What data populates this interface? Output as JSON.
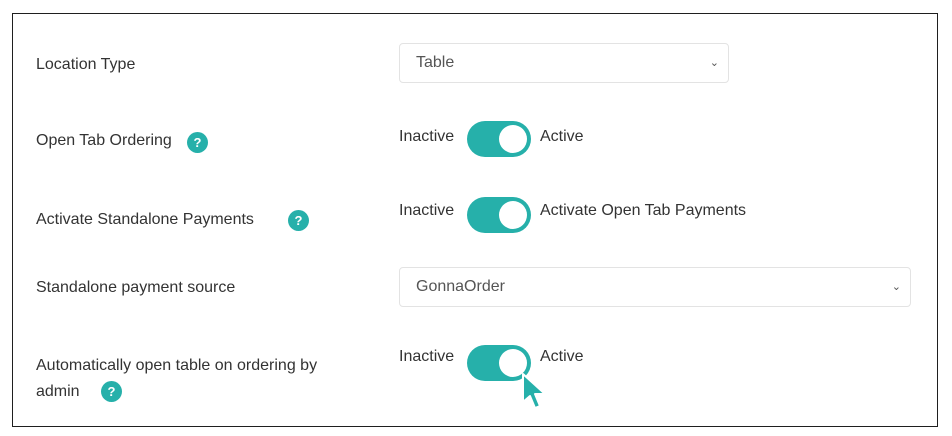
{
  "form": {
    "location_type": {
      "label": "Location Type",
      "value": "Table"
    },
    "open_tab_ordering": {
      "label": "Open Tab Ordering",
      "help": "?",
      "off_label": "Inactive",
      "on_label": "Active",
      "state": "on"
    },
    "standalone_payments": {
      "label": "Activate Standalone Payments",
      "help": "?",
      "off_label": "Inactive",
      "on_label": "Activate Open Tab Payments",
      "state": "on"
    },
    "payment_source": {
      "label": "Standalone payment source",
      "value": "GonnaOrder"
    },
    "auto_open_table": {
      "label_line1": "Automatically open table on ordering by",
      "label_line2": "admin",
      "help": "?",
      "off_label": "Inactive",
      "on_label": "Active",
      "state": "on"
    }
  },
  "icons": {
    "select_chevron": "chevron-down-icon",
    "help": "question-icon",
    "cursor": "pointer-cursor-icon"
  },
  "colors": {
    "accent": "#26b0aa",
    "text": "#333333",
    "select_border": "#e3e3e3"
  }
}
